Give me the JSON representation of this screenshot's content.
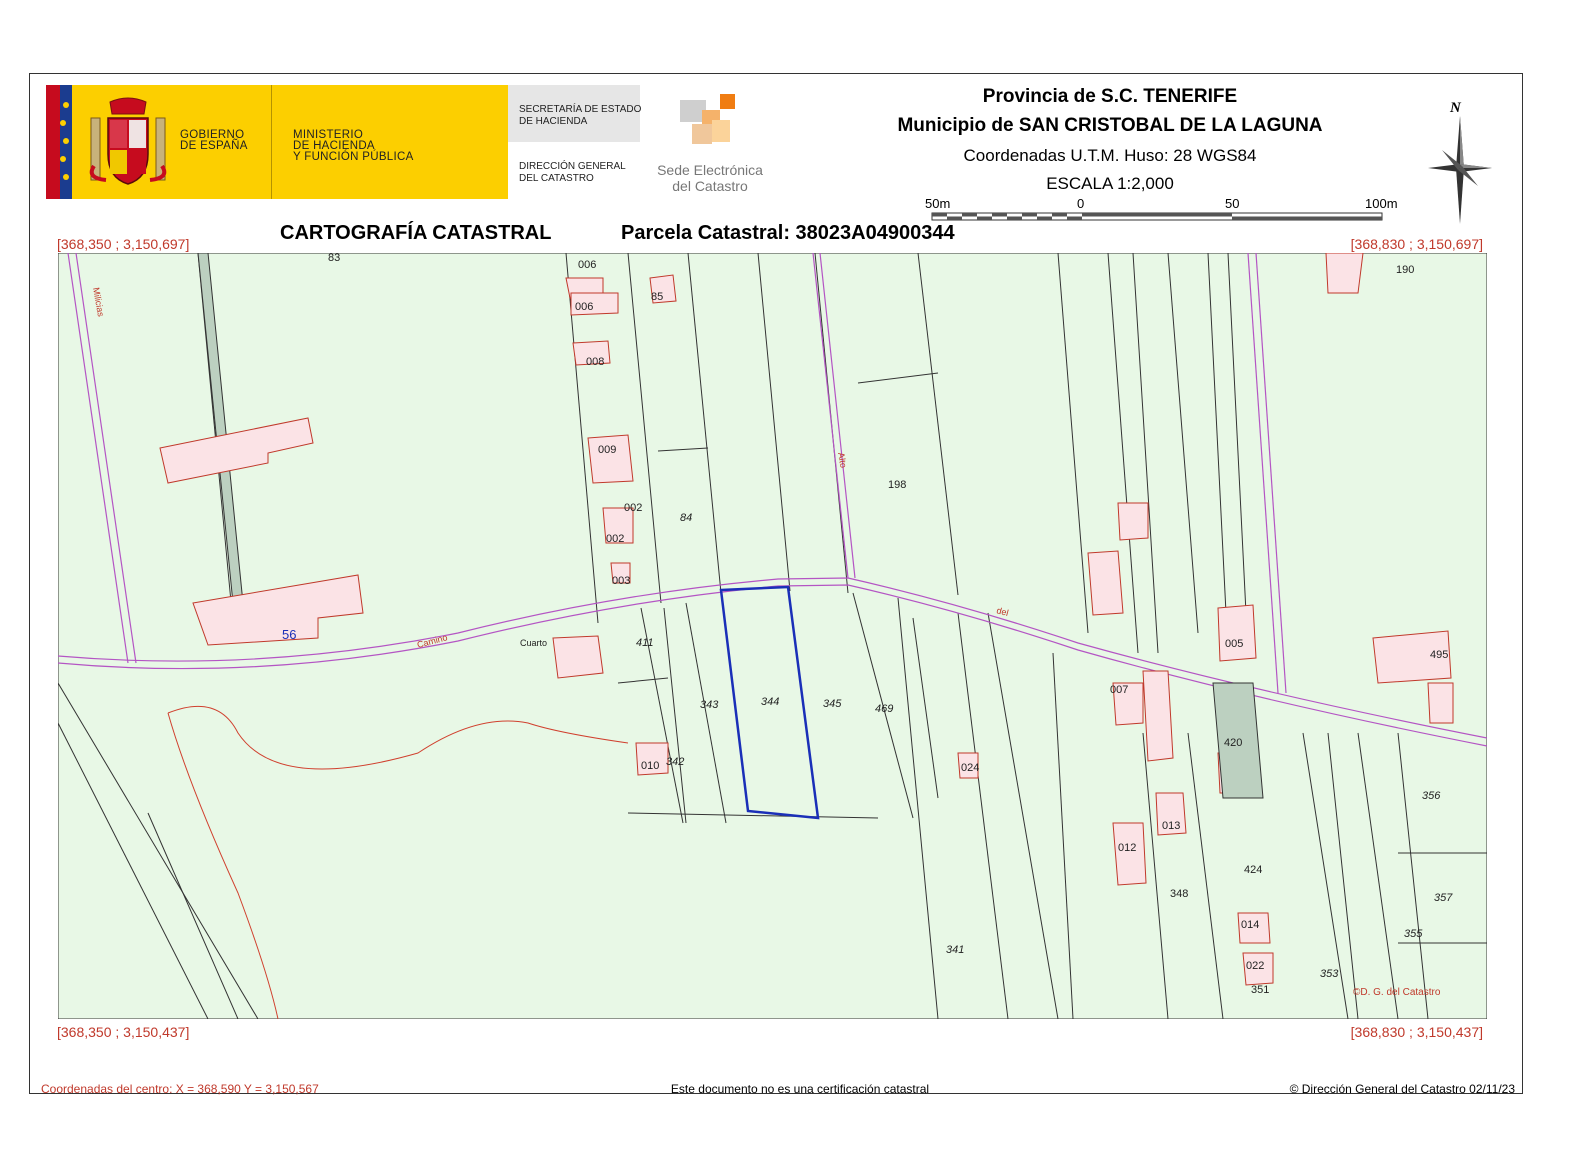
{
  "logos": {
    "gobierno": [
      "GOBIERNO",
      "DE ESPAÑA"
    ],
    "ministerio": [
      "MINISTERIO",
      "DE HACIENDA",
      "Y FUNCIÓN PÚBLICA"
    ],
    "secretaria": [
      "SECRETARÍA DE ESTADO",
      "DE HACIENDA"
    ],
    "direccion": [
      "DIRECCIÓN GENERAL",
      "DEL CATASTRO"
    ],
    "sede": [
      "Sede Electrónica",
      "del Catastro"
    ]
  },
  "header": {
    "provincia": "Provincia de S.C. TENERIFE",
    "municipio": "Municipio de SAN CRISTOBAL DE LA LAGUNA",
    "coordenadas": "Coordenadas U.T.M. Huso: 28 WGS84",
    "escala": "ESCALA 1:2,000",
    "scale_labels": [
      "50m",
      "0",
      "50",
      "100m"
    ],
    "north": "N"
  },
  "title": {
    "cartografia": "CARTOGRAFÍA CATASTRAL",
    "parcela": "Parcela Catastral: 38023A04900344"
  },
  "corners": {
    "top_left": "[368,350 ; 3,150,697]",
    "top_right": "[368,830 ; 3,150,697]",
    "bottom_left": "[368,350 ; 3,150,437]",
    "bottom_right": "[368,830 ; 3,150,437]"
  },
  "map": {
    "colors": {
      "background": "#e8f8e6",
      "road": "#b455c4",
      "building_fill": "#fbe3e6",
      "building_stroke": "#c0392b",
      "parcel_line": "#222222",
      "highlight": "#1a2fb8",
      "plot_text": "#c0392b"
    },
    "parcel_labels": [
      "83",
      "85",
      "84",
      "198",
      "411",
      "343",
      "344",
      "345",
      "469",
      "342",
      "341",
      "348",
      "356",
      "357",
      "355",
      "353",
      "351",
      "190",
      "495",
      "420",
      "424",
      "56"
    ],
    "building_labels": [
      "006",
      "006",
      "008",
      "009",
      "002",
      "002",
      "003",
      "010",
      "024",
      "007",
      "013",
      "012",
      "005",
      "014",
      "022"
    ],
    "road_labels": [
      "Camino",
      "del"
    ],
    "other_labels": [
      "Cuarto",
      "Milicias",
      "Alto"
    ],
    "credit": "©D. G. del Catastro"
  },
  "footer": {
    "centro": "Coordenadas del centro: X = 368,590 Y = 3,150,567",
    "aviso": "Este documento no es una certificación catastral",
    "copyright": "© Dirección General del Catastro 02/11/23"
  }
}
